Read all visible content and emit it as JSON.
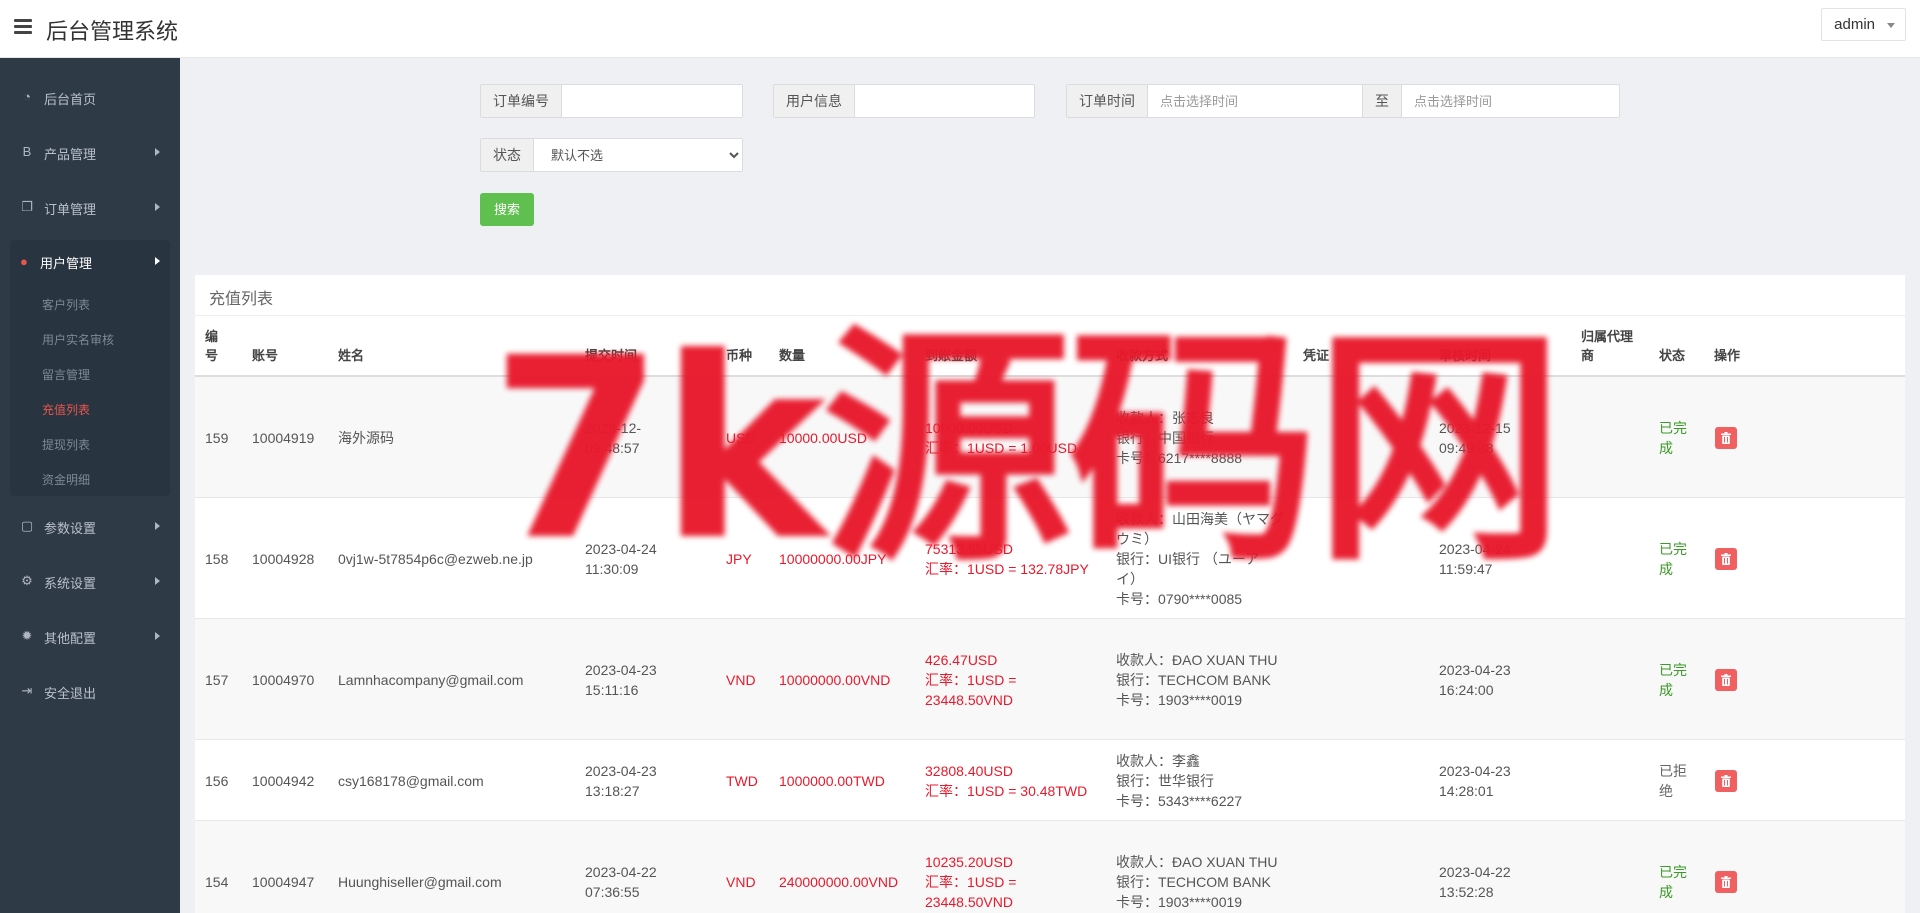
{
  "header": {
    "title": "后台管理系统",
    "user": "admin"
  },
  "sidebar": {
    "items_top": [
      {
        "icon": "dashboard-icon",
        "glyph": "◔",
        "label": "后台首页",
        "arrow": false
      },
      {
        "icon": "bitcoin-icon",
        "glyph": "B",
        "label": "产品管理",
        "arrow": true
      },
      {
        "icon": "copy-icon",
        "glyph": "❐",
        "label": "订单管理",
        "arrow": true
      }
    ],
    "group": {
      "icon": "user-icon",
      "glyph": "●",
      "label": "用户管理",
      "subitems": [
        "客户列表",
        "用户实名审核",
        "留言管理",
        "充值列表",
        "提现列表",
        "资金明细"
      ],
      "active": "充值列表"
    },
    "items_bottom": [
      {
        "icon": "file-icon",
        "glyph": "▢",
        "label": "参数设置",
        "arrow": true
      },
      {
        "icon": "cogs-icon",
        "glyph": "⚙",
        "label": "系统设置",
        "arrow": true
      },
      {
        "icon": "gear-icon",
        "glyph": "✹",
        "label": "其他配置",
        "arrow": true
      },
      {
        "icon": "sign-out-icon",
        "glyph": "⇥",
        "label": "安全退出",
        "arrow": false
      }
    ]
  },
  "search": {
    "order_no_label": "订单编号",
    "order_no_value": "",
    "user_info_label": "用户信息",
    "user_info_value": "",
    "order_time_label": "订单时间",
    "time_start_placeholder": "点击选择时间",
    "to_label": "至",
    "time_end_placeholder": "点击选择时间",
    "status_label": "状态",
    "status_selected": "默认不选",
    "search_button": "搜索"
  },
  "panel": {
    "title": "充值列表",
    "columns": {
      "id": [
        "编",
        "号"
      ],
      "account": "账号",
      "name": "姓名",
      "submit_time": "提交时间",
      "currency": "币种",
      "amount": "数量",
      "arrival": "到账金额",
      "payment": "收款方式",
      "voucher": "凭证",
      "review_time": "审核时间",
      "agent": [
        "归属代理",
        "商"
      ],
      "status": "状态",
      "action": "操作"
    },
    "rows": [
      {
        "id": "159",
        "account": "10004919",
        "name": "海外源码",
        "submit_time": [
          "2023-12-",
          "09:48:57"
        ],
        "currency": "USD",
        "amount": "10000.00USD",
        "arrival": [
          "10000.00USD",
          "汇率：1USD = 1.00USD"
        ],
        "payment": [
          "收款人：张志良",
          "银行：中国银行",
          "卡号：6217****8888"
        ],
        "review_time": [
          "2023-12-15",
          "09:49:38"
        ],
        "status": [
          "已完",
          "成"
        ],
        "status_type": "done"
      },
      {
        "id": "158",
        "account": "10004928",
        "name": "0vj1w-5t7854p6c@ezweb.ne.jp",
        "submit_time": [
          "2023-04-24",
          "11:30:09"
        ],
        "currency": "JPY",
        "amount": "10000000.00JPY",
        "arrival": [
          "75313.55USD",
          "汇率：1USD = 132.78JPY"
        ],
        "payment": [
          "收款人：山田海美（ヤマダ",
          "ウミ）",
          "银行：UI银行 （ユーア",
          "イ）",
          "卡号：0790****0085"
        ],
        "review_time": [
          "2023-04-24",
          "11:59:47"
        ],
        "status": [
          "已完",
          "成"
        ],
        "status_type": "done"
      },
      {
        "id": "157",
        "account": "10004970",
        "name": "Lamnhacompany@gmail.com",
        "submit_time": [
          "2023-04-23",
          "15:11:16"
        ],
        "currency": "VND",
        "amount": "10000000.00VND",
        "arrival": [
          "426.47USD",
          "汇率：1USD =",
          "23448.50VND"
        ],
        "payment": [
          "收款人：ĐAO XUAN THU",
          "银行：TECHCOM BANK",
          "卡号：1903****0019"
        ],
        "review_time": [
          "2023-04-23",
          "16:24:00"
        ],
        "status": [
          "已完",
          "成"
        ],
        "status_type": "done"
      },
      {
        "id": "156",
        "account": "10004942",
        "name": "csy168178@gmail.com",
        "submit_time": [
          "2023-04-23",
          "13:18:27"
        ],
        "currency": "TWD",
        "amount": "1000000.00TWD",
        "arrival": [
          "32808.40USD",
          "汇率：1USD = 30.48TWD"
        ],
        "payment": [
          "收款人：李鑫",
          "银行：世华银行",
          "卡号：5343****6227"
        ],
        "review_time": [
          "2023-04-23",
          "14:28:01"
        ],
        "status": [
          "已拒",
          "绝"
        ],
        "status_type": "rejected"
      },
      {
        "id": "154",
        "account": "10004947",
        "name": "Huunghiseller@gmail.com",
        "submit_time": [
          "2023-04-22",
          "07:36:55"
        ],
        "currency": "VND",
        "amount": "240000000.00VND",
        "arrival": [
          "10235.20USD",
          "汇率：1USD =",
          "23448.50VND"
        ],
        "payment": [
          "收款人：ĐAO XUAN THU",
          "银行：TECHCOM BANK",
          "卡号：1903****0019"
        ],
        "review_time": [
          "2023-04-22",
          "13:52:28"
        ],
        "status": [
          "已完",
          "成"
        ],
        "status_type": "done"
      }
    ]
  },
  "watermark": "7k源码网",
  "colors": {
    "sidebar": "#2f3a47",
    "accent_red": "#e8192c",
    "success_green": "#3b9a28",
    "search_green": "#5fbf4f",
    "delete_red": "#f06060"
  }
}
